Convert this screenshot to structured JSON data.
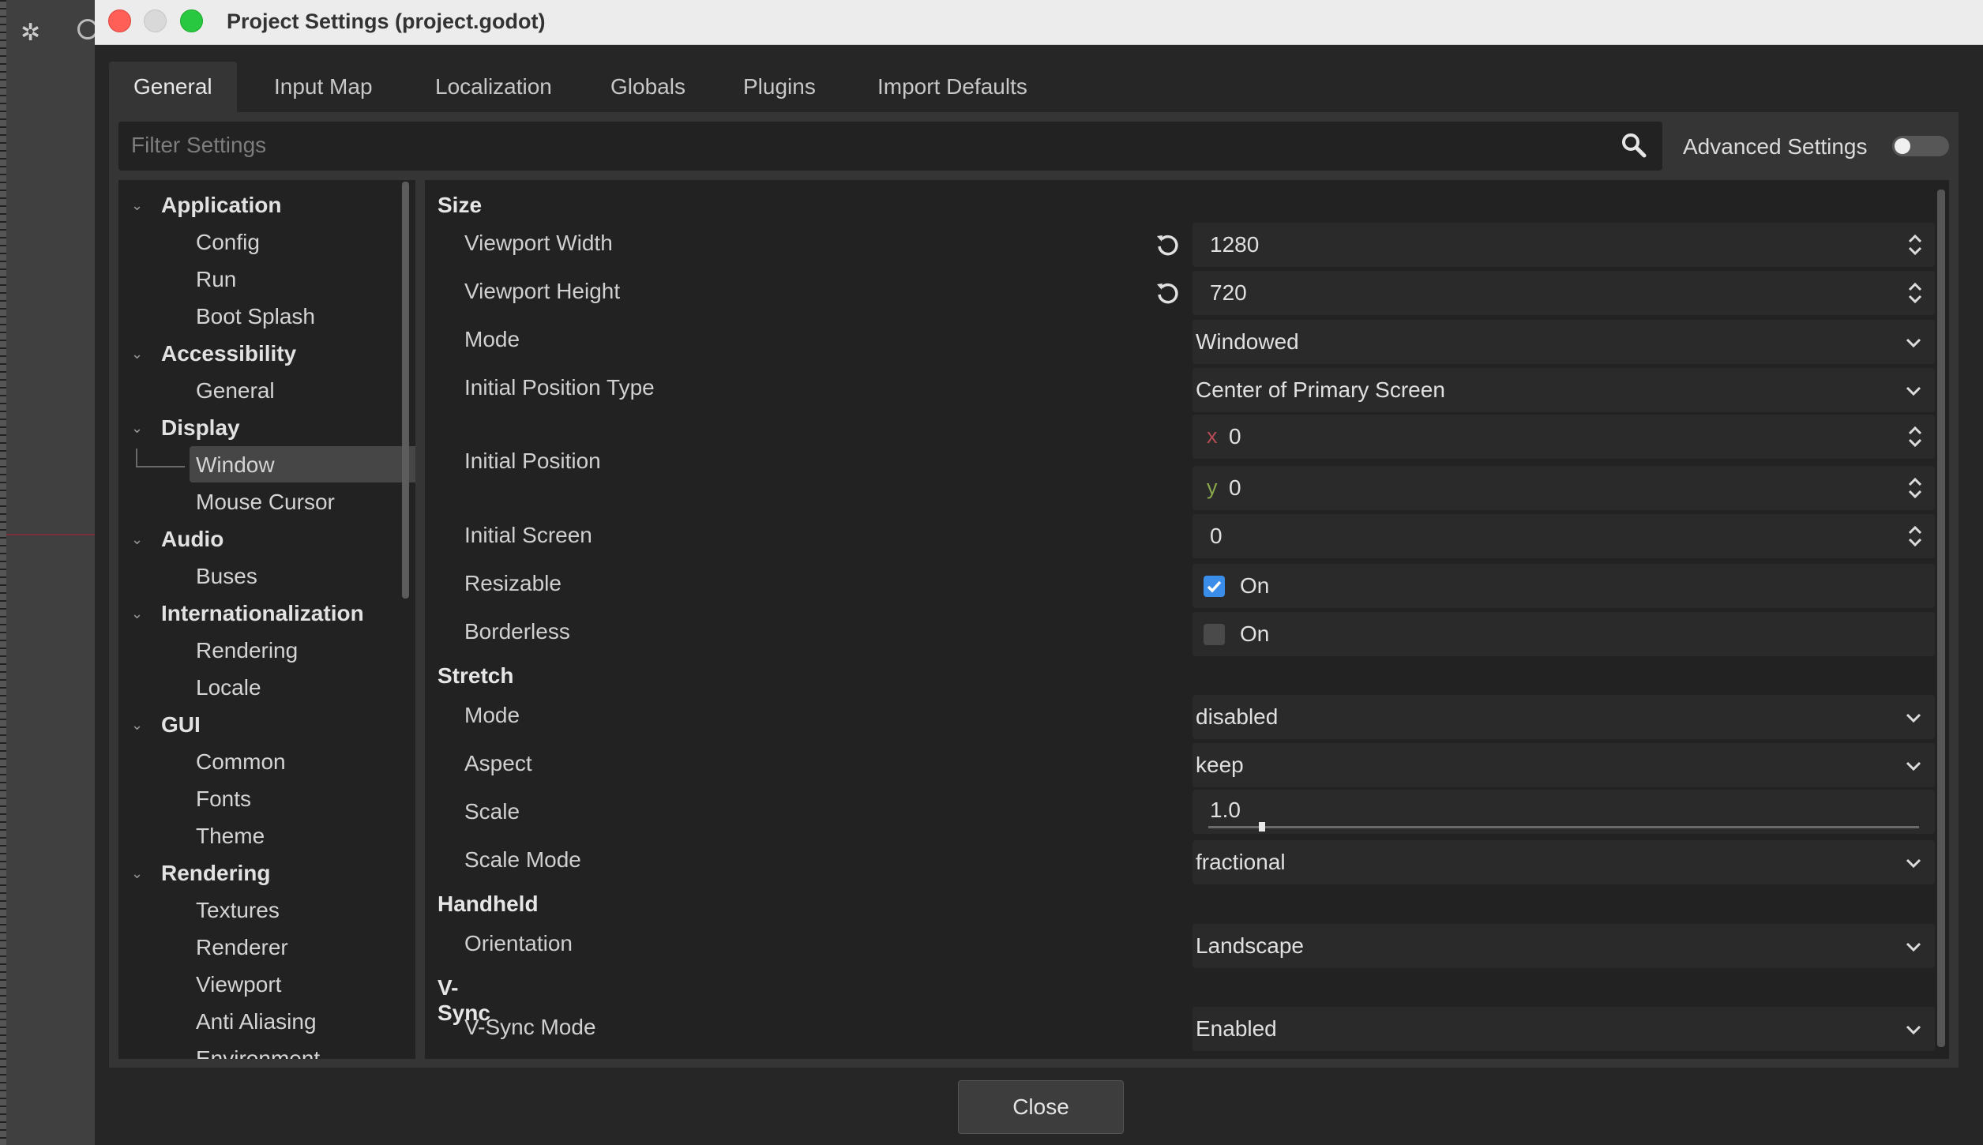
{
  "window": {
    "title": "Project Settings (project.godot)"
  },
  "tabs": [
    {
      "label": "General"
    },
    {
      "label": "Input Map"
    },
    {
      "label": "Localization"
    },
    {
      "label": "Globals"
    },
    {
      "label": "Plugins"
    },
    {
      "label": "Import Defaults"
    }
  ],
  "filter": {
    "placeholder": "Filter Settings",
    "advanced_label": "Advanced Settings",
    "advanced_on": false
  },
  "tree": [
    {
      "label": "Application",
      "type": "section"
    },
    {
      "label": "Config",
      "type": "item"
    },
    {
      "label": "Run",
      "type": "item"
    },
    {
      "label": "Boot Splash",
      "type": "item"
    },
    {
      "label": "Accessibility",
      "type": "section"
    },
    {
      "label": "General",
      "type": "item"
    },
    {
      "label": "Display",
      "type": "section"
    },
    {
      "label": "Window",
      "type": "item",
      "selected": true
    },
    {
      "label": "Mouse Cursor",
      "type": "item"
    },
    {
      "label": "Audio",
      "type": "section"
    },
    {
      "label": "Buses",
      "type": "item"
    },
    {
      "label": "Internationalization",
      "type": "section"
    },
    {
      "label": "Rendering",
      "type": "item"
    },
    {
      "label": "Locale",
      "type": "item"
    },
    {
      "label": "GUI",
      "type": "section"
    },
    {
      "label": "Common",
      "type": "item"
    },
    {
      "label": "Fonts",
      "type": "item"
    },
    {
      "label": "Theme",
      "type": "item"
    },
    {
      "label": "Rendering",
      "type": "section"
    },
    {
      "label": "Textures",
      "type": "item"
    },
    {
      "label": "Renderer",
      "type": "item"
    },
    {
      "label": "Viewport",
      "type": "item"
    },
    {
      "label": "Anti Aliasing",
      "type": "item"
    },
    {
      "label": "Environment",
      "type": "item"
    }
  ],
  "inspector": {
    "categories": {
      "size": "Size",
      "stretch": "Stretch",
      "handheld": "Handheld",
      "vsync": "V-Sync"
    },
    "viewport_width": {
      "label": "Viewport Width",
      "value": "1280"
    },
    "viewport_height": {
      "label": "Viewport Height",
      "value": "720"
    },
    "mode": {
      "label": "Mode",
      "value": "Windowed"
    },
    "initial_position_type": {
      "label": "Initial Position Type",
      "value": "Center of Primary Screen"
    },
    "initial_position": {
      "label": "Initial Position",
      "x_axis": "x",
      "x": "0",
      "y_axis": "y",
      "y": "0"
    },
    "initial_screen": {
      "label": "Initial Screen",
      "value": "0"
    },
    "resizable": {
      "label": "Resizable",
      "text": "On",
      "checked": true
    },
    "borderless": {
      "label": "Borderless",
      "text": "On",
      "checked": false
    },
    "stretch_mode": {
      "label": "Mode",
      "value": "disabled"
    },
    "aspect": {
      "label": "Aspect",
      "value": "keep"
    },
    "scale": {
      "label": "Scale",
      "value": "1.0"
    },
    "scale_mode": {
      "label": "Scale Mode",
      "value": "fractional"
    },
    "orientation": {
      "label": "Orientation",
      "value": "Landscape"
    },
    "vsync_mode": {
      "label": "V-Sync Mode",
      "value": "Enabled"
    }
  },
  "footer": {
    "close_label": "Close"
  },
  "colors": {
    "checkbox_on": "#3a8de8",
    "axis_x": "#b54b55",
    "axis_y": "#8aa84c"
  },
  "icons": [
    "search-icon",
    "reset-icon",
    "spinner-icon",
    "chevron-down-icon",
    "collapse-arrow-icon"
  ]
}
